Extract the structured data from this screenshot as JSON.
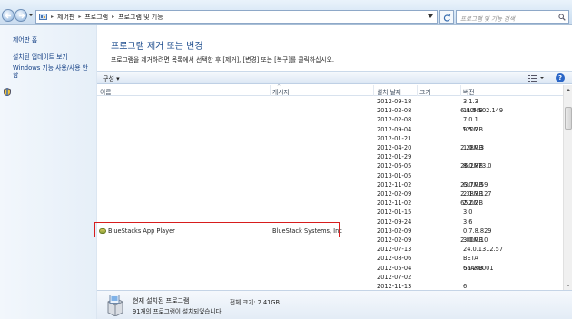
{
  "address": {
    "crumbs": [
      "제어판",
      "프로그램",
      "프로그램 및 기능"
    ],
    "search_placeholder": "프로그램 및 기능 검색"
  },
  "left_pane": {
    "links": [
      "제어판 홈",
      "설치된 업데이트 보기",
      "Windows 기능 사용/사용 안",
      "함"
    ]
  },
  "main": {
    "title": "프로그램 제거 또는 변경",
    "subtitle": "프로그램을 제거하려면 목록에서 선택한 후 [제거], [변경] 또는 [복구]를 클릭하십시오."
  },
  "toolbar": {
    "organize_label": "구성 ▾",
    "help_label": "?"
  },
  "columns": [
    "이름",
    "게시자",
    "설치 날짜",
    "크기",
    "버전"
  ],
  "rows": [
    {
      "name": "",
      "publisher": "",
      "date": "2012-09-18",
      "size": "",
      "version": "3.1.3"
    },
    {
      "name": "",
      "publisher": "",
      "date": "2013-02-08",
      "size": "6.00MB",
      "version": "11.5.502.149"
    },
    {
      "name": "",
      "publisher": "",
      "date": "2012-02-08",
      "size": "",
      "version": "7.0.1"
    },
    {
      "name": "",
      "publisher": "",
      "date": "2012-09-04",
      "size": "120MB",
      "version": "9.5.2"
    },
    {
      "name": "",
      "publisher": "",
      "date": "2012-01-21",
      "size": "",
      "version": ""
    },
    {
      "name": "",
      "publisher": "",
      "date": "2012-04-20",
      "size": "2.28MB",
      "version": "1.0.0.3"
    },
    {
      "name": "",
      "publisher": "",
      "date": "2012-01-29",
      "size": "",
      "version": ""
    },
    {
      "name": "",
      "publisher": "",
      "date": "2012-06-05",
      "size": "26.2MB",
      "version": "8.0.873.0"
    },
    {
      "name": "",
      "publisher": "",
      "date": "2013-01-05",
      "size": "",
      "version": ""
    },
    {
      "name": "",
      "publisher": "",
      "date": "2012-11-02",
      "size": "23.7MB",
      "version": "6.0.0.59"
    },
    {
      "name": "",
      "publisher": "",
      "date": "2012-02-09",
      "size": "2.38MB",
      "version": "2.1.3.127"
    },
    {
      "name": "",
      "publisher": "",
      "date": "2012-11-02",
      "size": "65.0MB",
      "version": "2.2.2"
    },
    {
      "name": "",
      "publisher": "",
      "date": "2012-01-15",
      "size": "",
      "version": "3.0"
    },
    {
      "name": "",
      "publisher": "",
      "date": "2012-09-24",
      "size": "",
      "version": "3.6"
    },
    {
      "name": "BlueStacks App Player",
      "publisher": "BlueStack Systems, Inc",
      "date": "2013-02-09",
      "size": "",
      "version": "0.7.8.829"
    },
    {
      "name": "",
      "publisher": "",
      "date": "2012-02-09",
      "size": "2.00MB",
      "version": "3.0.0.10"
    },
    {
      "name": "",
      "publisher": "",
      "date": "2012-07-13",
      "size": "",
      "version": "24.0.1312.57"
    },
    {
      "name": "",
      "publisher": "",
      "date": "2012-08-06",
      "size": "",
      "version": "BETA"
    },
    {
      "name": "",
      "publisher": "",
      "date": "2012-05-04",
      "size": "554KB",
      "version": "6.02.0001"
    },
    {
      "name": "",
      "publisher": "",
      "date": "2012-07-02",
      "size": "",
      "version": ""
    },
    {
      "name": "",
      "publisher": "",
      "date": "2012-11-13",
      "size": "",
      "version": "6"
    }
  ],
  "details": {
    "title": "현재 설치된 프로그램",
    "total_size": "전체 크기: 2.41GB",
    "count": "91개의 프로그램이 설치되었습니다."
  }
}
